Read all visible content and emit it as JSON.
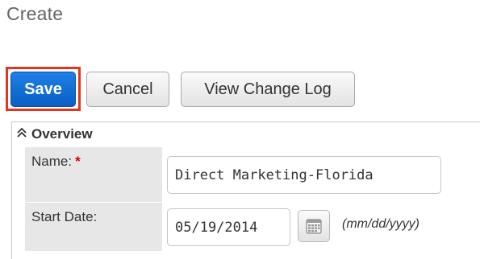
{
  "page": {
    "title": "Create"
  },
  "toolbar": {
    "save_label": "Save",
    "cancel_label": "Cancel",
    "view_log_label": "View Change Log"
  },
  "panel": {
    "title": "Overview",
    "fields": {
      "name": {
        "label": "Name:",
        "required_mark": "*",
        "value": "Direct Marketing-Florida"
      },
      "start_date": {
        "label": "Start Date:",
        "value": "05/19/2014",
        "format_hint": "(mm/dd/yyyy)"
      }
    }
  },
  "icons": {
    "panel_toggle": "double-chevron-up-icon",
    "date_picker": "calendar-icon"
  },
  "colors": {
    "primary_button": "#0a5fc4",
    "highlight_border": "#e3341c",
    "required_mark": "#d40000",
    "label_background": "#e7e7e7"
  }
}
